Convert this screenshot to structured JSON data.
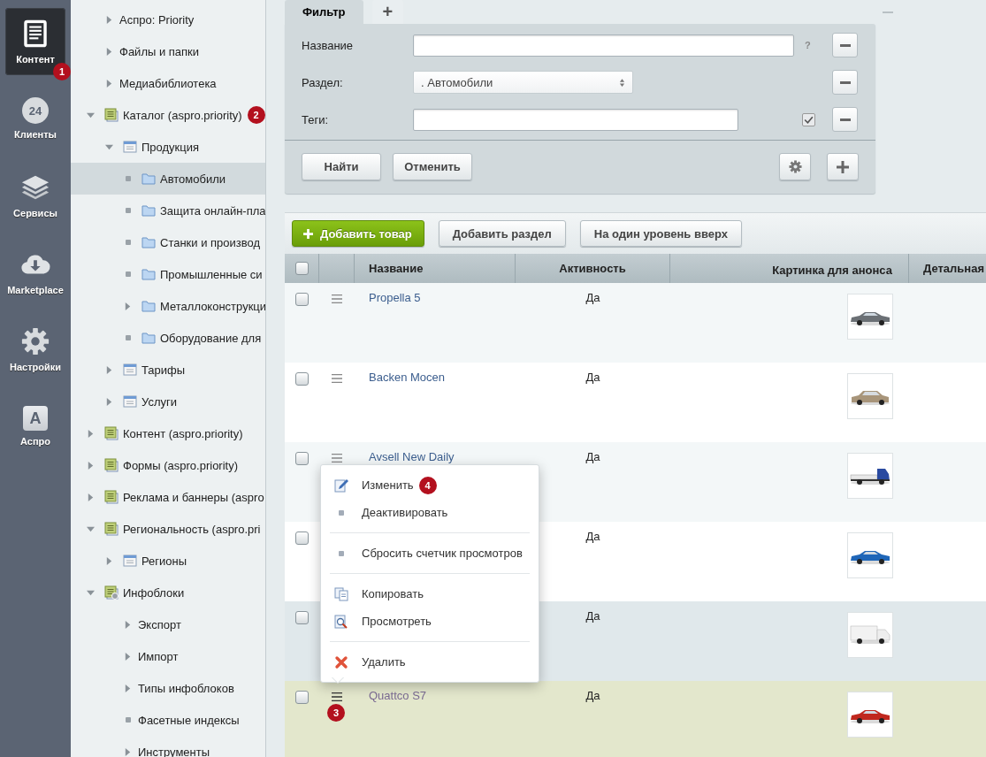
{
  "nav": [
    {
      "label": "Контент",
      "kind": "document",
      "selected": true,
      "badge": "1"
    },
    {
      "label": "Клиенты",
      "kind": "cloud",
      "icon_text": "24",
      "selected": false
    },
    {
      "label": "Сервисы",
      "kind": "layers",
      "selected": false
    },
    {
      "label": "Marketplace",
      "kind": "download",
      "selected": false
    },
    {
      "label": "Настройки",
      "kind": "gear",
      "selected": false
    },
    {
      "label": "Аспро",
      "kind": "tile",
      "icon_text": "A",
      "selected": false
    }
  ],
  "tree": [
    {
      "label": "Аспро: Priority",
      "kind": "plain",
      "expanded": false,
      "selected": false
    },
    {
      "label": "Файлы и папки",
      "kind": "plain",
      "expanded": false,
      "selected": false
    },
    {
      "label": "Медиабиблиотека",
      "kind": "plain",
      "expanded": false,
      "selected": false
    },
    {
      "label": "Каталог (aspro.priority)",
      "kind": "module",
      "expanded": true,
      "selected": false,
      "badge": "2",
      "children": [
        {
          "label": "Продукция",
          "kind": "list",
          "expanded": true,
          "selected": false,
          "children": [
            {
              "label": "Автомобили",
              "kind": "folder",
              "selected": true
            },
            {
              "label": "Защита онлайн-пла",
              "kind": "folder",
              "selected": false
            },
            {
              "label": "Станки и производ",
              "kind": "folder",
              "selected": false
            },
            {
              "label": "Промышленные си",
              "kind": "folder",
              "selected": false
            },
            {
              "label": "Металлоконструкци",
              "kind": "folder",
              "expanded": false,
              "selected": false
            },
            {
              "label": "Оборудование для",
              "kind": "folder",
              "selected": false
            }
          ]
        },
        {
          "label": "Тарифы",
          "kind": "list",
          "expanded": false,
          "selected": false
        },
        {
          "label": "Услуги",
          "kind": "list",
          "expanded": false,
          "selected": false
        }
      ]
    },
    {
      "label": "Контент (aspro.priority)",
      "kind": "module",
      "expanded": false,
      "selected": false
    },
    {
      "label": "Формы (aspro.priority)",
      "kind": "module",
      "expanded": false,
      "selected": false
    },
    {
      "label": "Реклама и баннеры (aspro",
      "kind": "module",
      "expanded": false,
      "selected": false
    },
    {
      "label": "Региональность (aspro.pri",
      "kind": "module",
      "expanded": true,
      "selected": false,
      "children": [
        {
          "label": "Регионы",
          "kind": "list",
          "expanded": false,
          "selected": false
        }
      ]
    },
    {
      "label": "Инфоблоки",
      "kind": "settings",
      "expanded": true,
      "selected": false,
      "children": [
        {
          "label": "Экспорт",
          "kind": "plain",
          "expanded": false,
          "selected": false
        },
        {
          "label": "Импорт",
          "kind": "plain",
          "expanded": false,
          "selected": false
        },
        {
          "label": "Типы инфоблоков",
          "kind": "plain",
          "expanded": false,
          "selected": false
        },
        {
          "label": "Фасетные индексы",
          "kind": "plain",
          "selected": false
        },
        {
          "label": "Инструменты",
          "kind": "plain",
          "expanded": false,
          "selected": false
        }
      ]
    }
  ],
  "filter": {
    "tabs": [
      {
        "label": "Фильтр",
        "selected": true
      },
      {
        "label": "+",
        "selected": false
      }
    ],
    "fields": [
      {
        "label": "Название",
        "kind": "text",
        "help": "?"
      },
      {
        "label": "Раздел:",
        "kind": "select",
        "value": ". Автомобили"
      },
      {
        "label": "Теги:",
        "kind": "text",
        "checked": true
      }
    ],
    "buttons": [
      "Найти",
      "Отменить"
    ]
  },
  "toolbar": [
    {
      "label": "Добавить товар",
      "kind": "primary"
    },
    {
      "label": "Добавить раздел",
      "kind": "default"
    },
    {
      "label": "На один уровень вверх",
      "kind": "default"
    }
  ],
  "table": {
    "all_checked": false,
    "columns": [
      "Название",
      "Активность",
      "Картинка для анонса",
      "Детальная"
    ],
    "rows": [
      {
        "name": "Propella 5",
        "active": "Да",
        "checked": false,
        "hovered": false,
        "menu_open": false
      },
      {
        "name": "Backen Mocen",
        "active": "Да",
        "checked": false,
        "hovered": false,
        "menu_open": false
      },
      {
        "name": "Avsell New Daily",
        "active": "Да",
        "checked": false,
        "hovered": false,
        "menu_open": false
      },
      {
        "active": "Да",
        "checked": false,
        "hovered": false,
        "menu_open": false
      },
      {
        "active": "Да",
        "checked": false,
        "hovered": true,
        "menu_open": false
      },
      {
        "name": "Quattco S7",
        "active": "Да",
        "checked": false,
        "hovered": false,
        "menu_open": true,
        "badge": "3"
      }
    ]
  },
  "context_menu": {
    "items": [
      {
        "kind": "edit",
        "label": "Изменить",
        "badge": "4"
      },
      {
        "kind": "action",
        "label": "Деактивировать"
      },
      {
        "kind": "separator"
      },
      {
        "kind": "action",
        "label": "Сбросить счетчик просмотров"
      },
      {
        "kind": "separator"
      },
      {
        "kind": "copy",
        "label": "Копировать"
      },
      {
        "kind": "view",
        "label": "Просмотреть"
      },
      {
        "kind": "separator"
      },
      {
        "kind": "delete",
        "label": "Удалить"
      }
    ]
  }
}
